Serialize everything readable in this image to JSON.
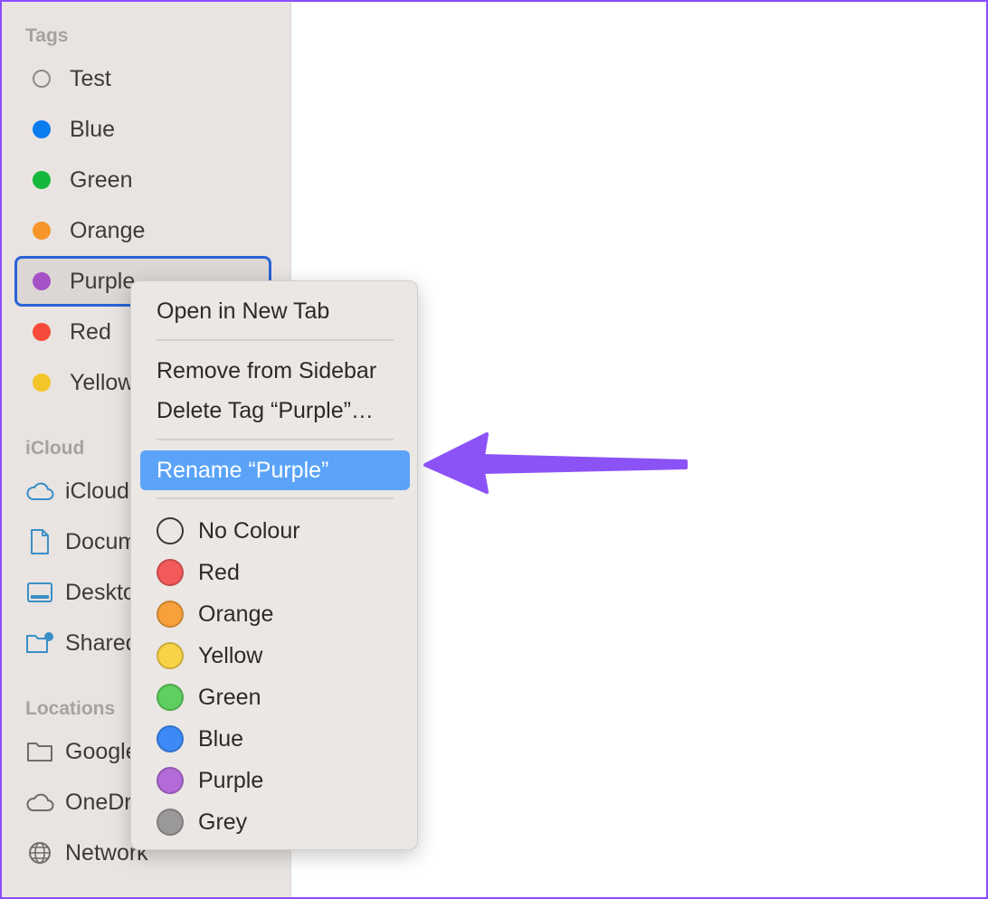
{
  "sidebar": {
    "tags_title": "Tags",
    "tags": [
      {
        "label": "Test",
        "color": "none"
      },
      {
        "label": "Blue",
        "color": "#0a7cf0"
      },
      {
        "label": "Green",
        "color": "#14b83a"
      },
      {
        "label": "Orange",
        "color": "#f5952a"
      },
      {
        "label": "Purple",
        "color": "#a551c6"
      },
      {
        "label": "Red",
        "color": "#f74a3a"
      },
      {
        "label": "Yellow",
        "color": "#f4c528"
      }
    ],
    "icloud_title": "iCloud",
    "icloud": [
      {
        "label": "iCloud Drive",
        "icon": "cloud-icon"
      },
      {
        "label": "Documents",
        "icon": "document-icon"
      },
      {
        "label": "Desktop",
        "icon": "desktop-icon"
      },
      {
        "label": "Shared",
        "icon": "shared-folder-icon"
      }
    ],
    "locations_title": "Locations",
    "locations": [
      {
        "label": "Google Drive",
        "icon": "folder-icon"
      },
      {
        "label": "OneDrive",
        "icon": "cloud-icon"
      },
      {
        "label": "Network",
        "icon": "globe-icon"
      }
    ]
  },
  "context_menu": {
    "open_new_tab": "Open in New Tab",
    "remove_sidebar": "Remove from Sidebar",
    "delete_tag": "Delete Tag “Purple”…",
    "rename": "Rename “Purple”",
    "colors": [
      {
        "label": "No Colour",
        "color": "none"
      },
      {
        "label": "Red",
        "color": "#f25a5a"
      },
      {
        "label": "Orange",
        "color": "#f7a03c"
      },
      {
        "label": "Yellow",
        "color": "#f8d247"
      },
      {
        "label": "Green",
        "color": "#5fcf5f"
      },
      {
        "label": "Blue",
        "color": "#3d8af7"
      },
      {
        "label": "Purple",
        "color": "#b36bd8"
      },
      {
        "label": "Grey",
        "color": "#9a9899"
      }
    ]
  },
  "annotation": {
    "arrow_color": "#8b52f6"
  }
}
